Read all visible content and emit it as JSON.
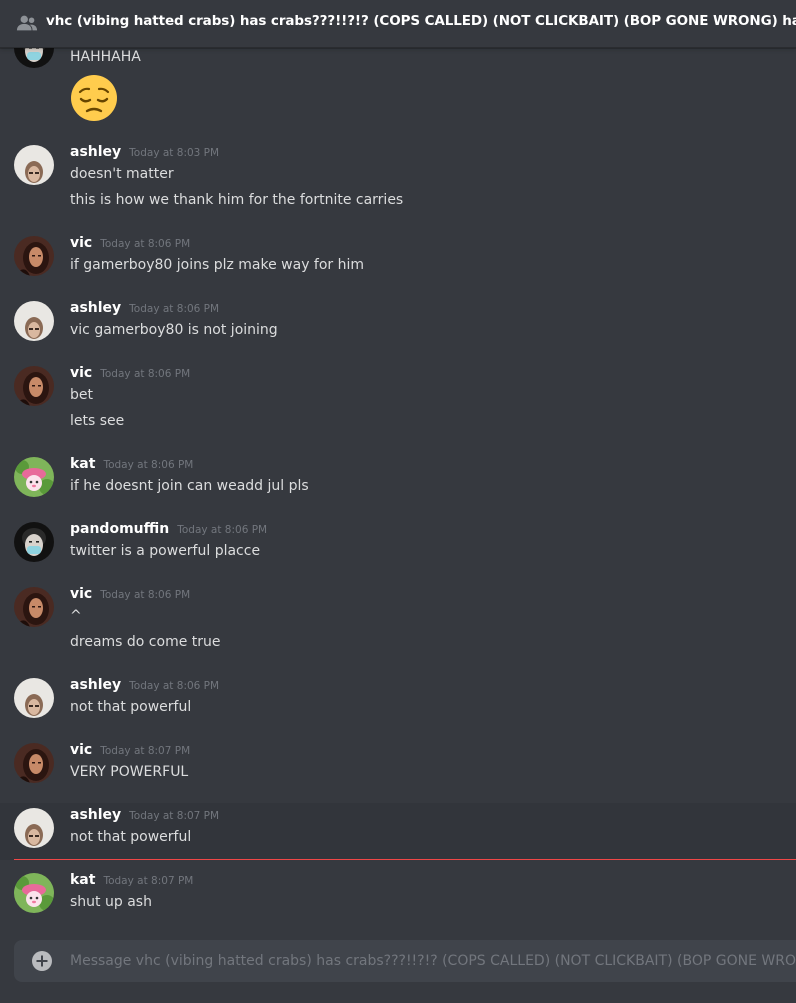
{
  "header": {
    "title": "vhc (vibing hatted crabs) has crabs???!!?!? (COPS CALLED) (NOT CLICKBAIT) (BOP GONE WRONG) haha",
    "icon": "members-icon"
  },
  "continued": {
    "text": "HAHHAHA",
    "emoji": "pensive-face"
  },
  "messages": [
    {
      "user": "ashley",
      "time": "Today at 8:03 PM",
      "lines": [
        "doesn't matter",
        "this is how we thank him for the fortnite carries"
      ]
    },
    {
      "user": "vic",
      "time": "Today at 8:06 PM",
      "lines": [
        "if gamerboy80 joins plz make way for him"
      ]
    },
    {
      "user": "ashley",
      "time": "Today at 8:06 PM",
      "lines": [
        "vic gamerboy80 is not joining"
      ]
    },
    {
      "user": "vic",
      "time": "Today at 8:06 PM",
      "lines": [
        "bet",
        "lets see"
      ]
    },
    {
      "user": "kat",
      "time": "Today at 8:06 PM",
      "lines": [
        "if he doesnt join can weadd jul pls"
      ]
    },
    {
      "user": "pandomuffin",
      "time": "Today at 8:06 PM",
      "lines": [
        "twitter is a powerful placce"
      ]
    },
    {
      "user": "vic",
      "time": "Today at 8:06 PM",
      "lines": [
        "^",
        "dreams do come true"
      ]
    },
    {
      "user": "ashley",
      "time": "Today at 8:06 PM",
      "lines": [
        "not that powerful"
      ]
    },
    {
      "user": "vic",
      "time": "Today at 8:07 PM",
      "lines": [
        "VERY POWERFUL"
      ]
    },
    {
      "user": "ashley",
      "time": "Today at 8:07 PM",
      "lines": [
        "not that powerful"
      ]
    },
    {
      "user": "kat",
      "time": "Today at 8:07 PM",
      "lines": [
        "shut up ash"
      ]
    }
  ],
  "composer": {
    "placeholder": "Message vhc (vibing hatted crabs) has crabs???!!?!? (COPS CALLED) (NOT CLICKBAIT) (BOP GONE WRONG) haha",
    "icon": "add-attachment-icon"
  },
  "colors": {
    "background": "#36393f",
    "text": "#dcddde",
    "username": "#ffffff",
    "timestamp": "#72767d",
    "new_messages_divider": "#f04747",
    "composer": "#40444b"
  }
}
